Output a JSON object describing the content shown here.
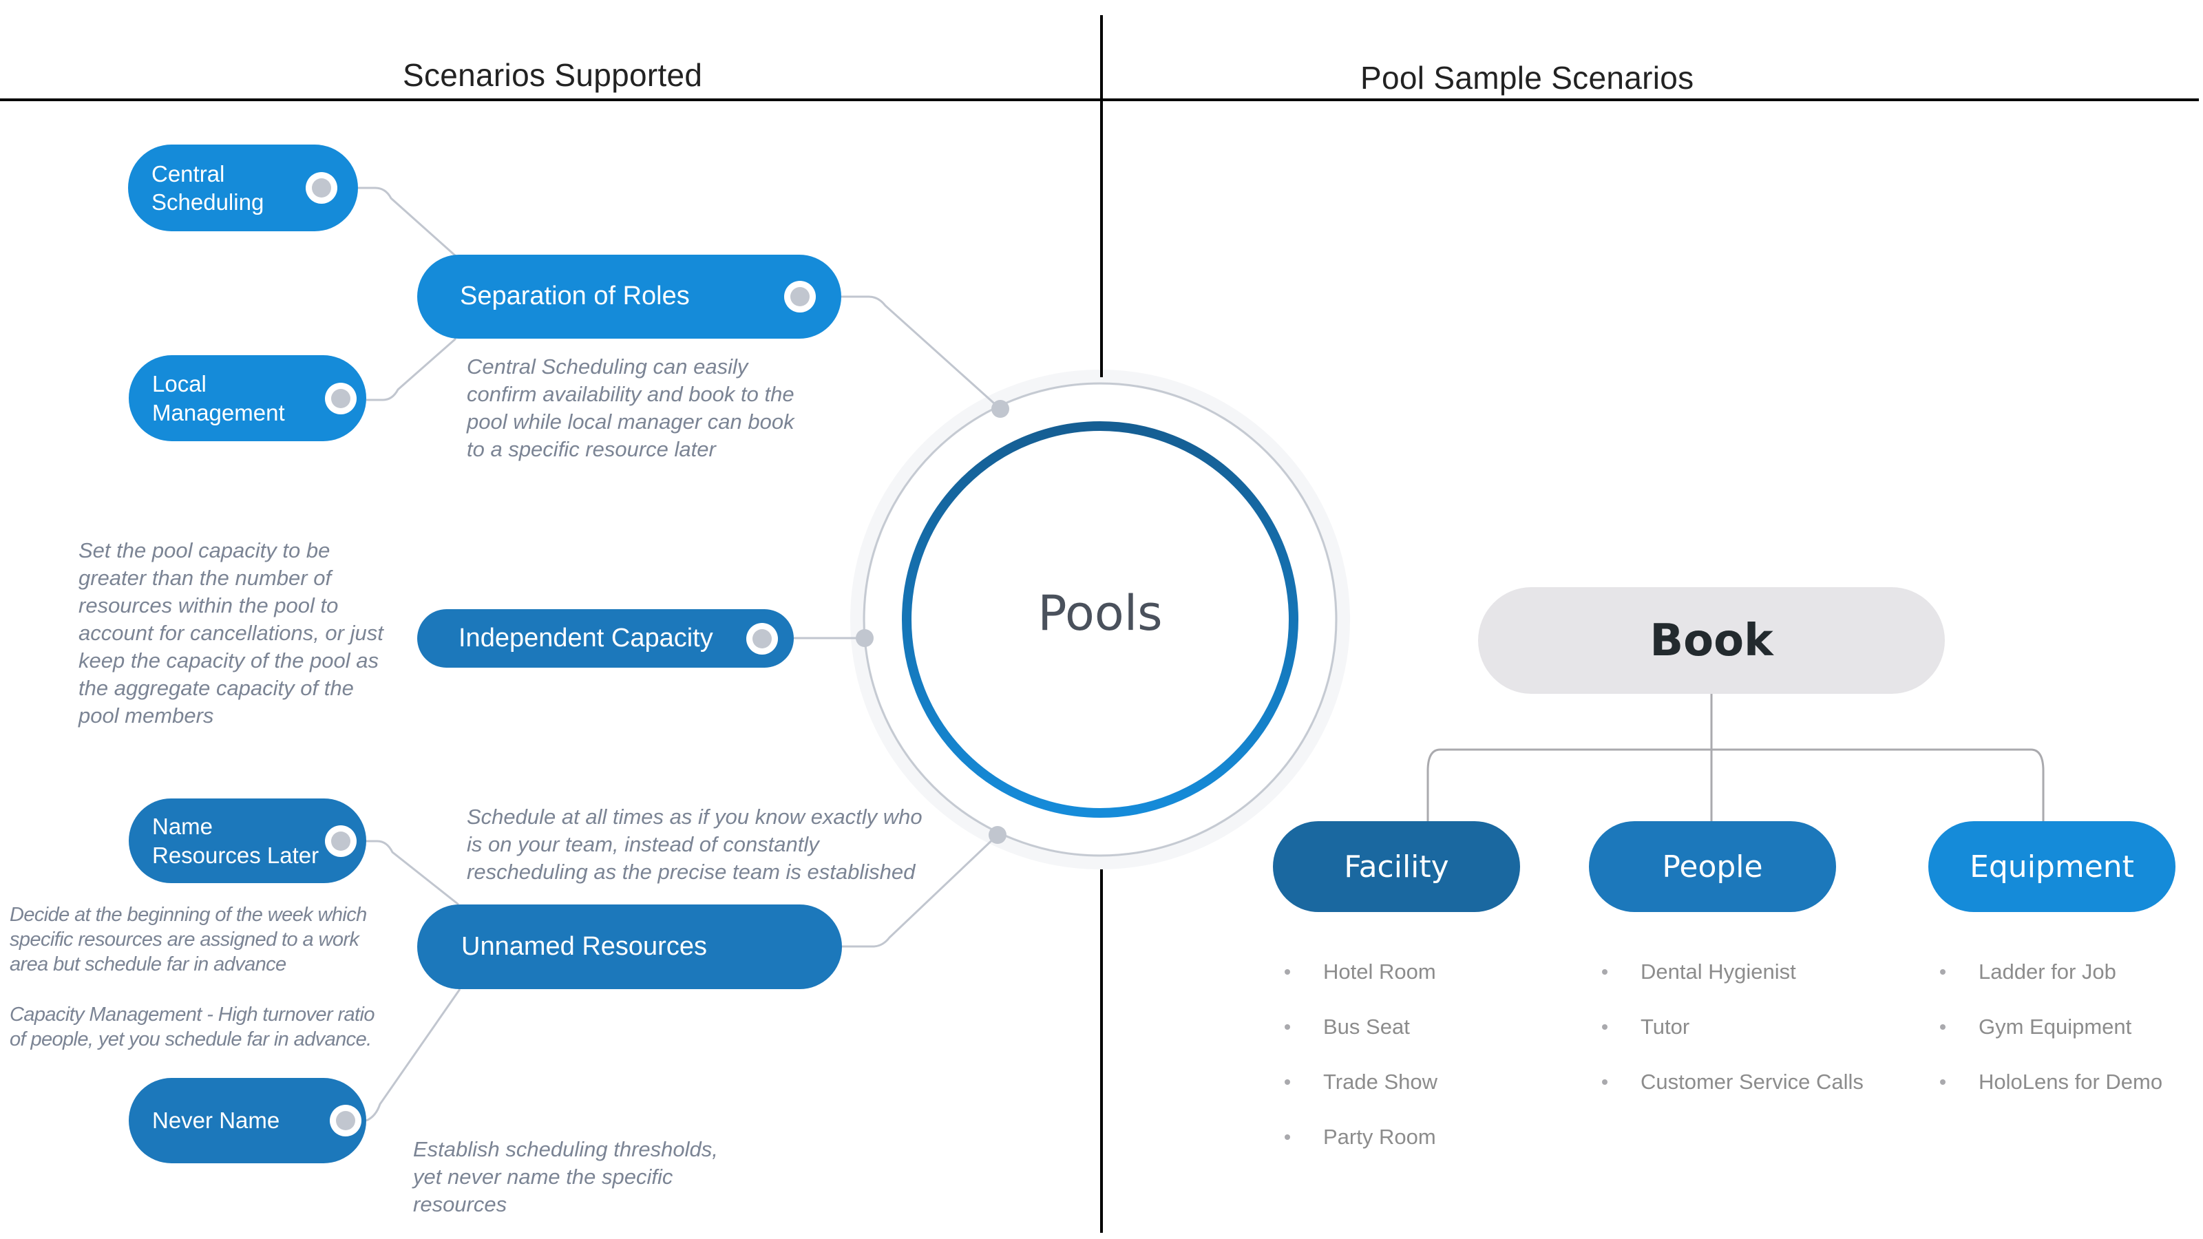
{
  "headings": {
    "left": "Scenarios Supported",
    "right": "Pool Sample Scenarios"
  },
  "center": {
    "label": "Pools",
    "ring_gradient": [
      "#155e93",
      "#158bd9"
    ]
  },
  "left_nodes": {
    "separation_of_roles": {
      "label": "Separation of Roles",
      "note": "Central Scheduling  can  easily\nconfirm  availability  and book to the\npool while  local  manager can book\nto a specific resource later",
      "children": [
        {
          "label": "Central\nScheduling"
        },
        {
          "label": "Local\nManagement"
        }
      ]
    },
    "independent_capacity": {
      "label": "Independent Capacity",
      "note": "Set the pool capacity to be\ngreater than the number of\nresources within  the pool to\naccount for cancellations,  or just\nkeep the capacity of the pool as\nthe aggregate  capacity of the\npool members"
    },
    "unnamed_resources": {
      "label": "Unnamed Resources",
      "note": "Schedule  at all times as if you know exactly who\nis on your team, instead of constantly\nrescheduling  as the precise  team is established",
      "children": [
        {
          "label": "Name\nResources  Later",
          "notes": [
            "Decide at the beginning of the week which\nspecific resources are assigned to a work\narea but schedule far in advance",
            "Capacity Management - High turnover ratio\nof people, yet you schedule far in advance."
          ]
        },
        {
          "label": "Never  Name",
          "note": "Establish  scheduling  thresholds,\nyet never name  the specific\nresources"
        }
      ]
    }
  },
  "colors": {
    "pill_light": "#158bd9",
    "pill_mid": "#1c78bb",
    "pill_dark": "#1a68a0",
    "connector": "#c1c6cf",
    "note_text": "#7b8494",
    "book_bg": "#e6e5e8"
  },
  "tree": {
    "root": "Book",
    "categories": [
      {
        "label": "Facility",
        "color": "#1a68a0",
        "items": [
          "Hotel Room",
          "Bus Seat",
          "Trade Show",
          "Party Room"
        ]
      },
      {
        "label": "People",
        "color": "#1c78bb",
        "items": [
          "Dental Hygienist",
          "Tutor",
          "Customer  Service Calls"
        ]
      },
      {
        "label": "Equipment",
        "color": "#158bd9",
        "items": [
          "Ladder  for Job",
          "Gym Equipment",
          "HoloLens  for Demo"
        ]
      }
    ]
  }
}
